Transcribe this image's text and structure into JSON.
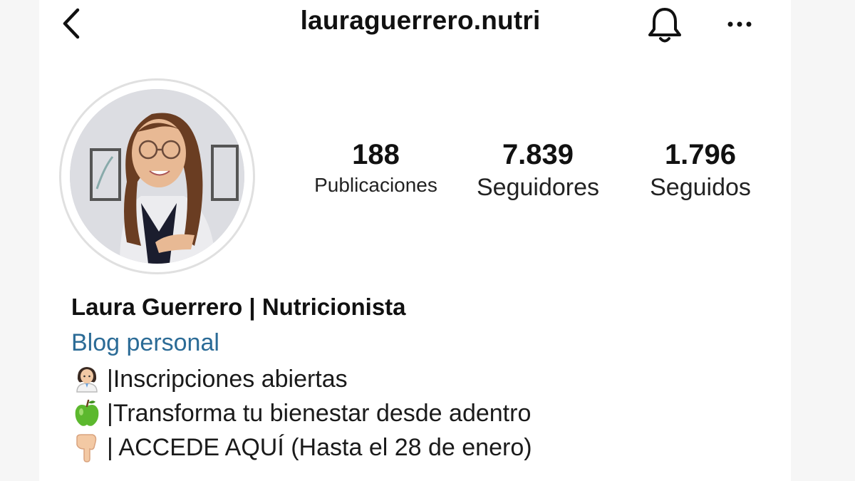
{
  "header": {
    "username": "lauraguerrero.nutri",
    "back_icon": "chevron-left-icon",
    "bell_icon": "bell-icon",
    "more_icon": "more-horizontal-icon"
  },
  "stats": {
    "posts_count": "188",
    "posts_label": "Publicaciones",
    "followers_count": "7.839",
    "followers_label": "Seguidores",
    "following_count": "1.796",
    "following_label": "Seguidos"
  },
  "bio": {
    "full_name": "Laura Guerrero | Nutricionista",
    "category": "Blog personal",
    "lines": [
      {
        "icon": "woman-health-worker-emoji",
        "text": "|Inscripciones abiertas"
      },
      {
        "icon": "green-apple-emoji",
        "text": "|Transforma tu bienestar desde adentro"
      },
      {
        "icon": "pointing-down-hand-emoji",
        "text": "| ACCEDE AQUÍ (Hasta el 28 de enero)"
      }
    ]
  },
  "colors": {
    "category_link": "#2b6b96",
    "text": "#111111",
    "background": "#ffffff"
  }
}
